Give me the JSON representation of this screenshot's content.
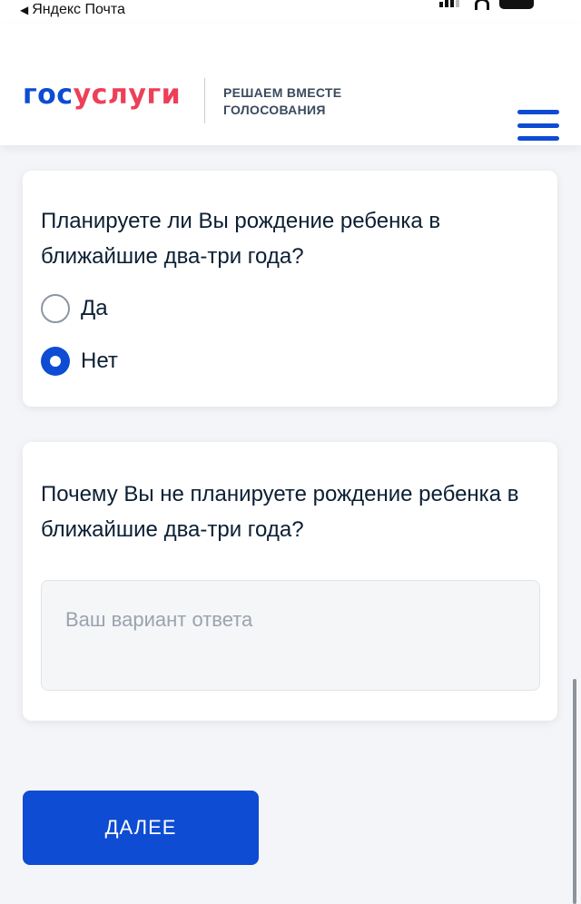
{
  "status_bar": {
    "back_app": "Яндекс Почта",
    "back_glyph": "◀"
  },
  "header": {
    "logo_part1": "гос",
    "logo_part2": "услуги",
    "tagline_line1": "РЕШАЕМ ВМЕСТЕ",
    "tagline_line2": "ГОЛОСОВАНИЯ"
  },
  "question1": {
    "text": "Планируете ли Вы рождение ребенка в ближайшие два-три года?",
    "options": [
      {
        "label": "Да",
        "selected": false
      },
      {
        "label": "Нет",
        "selected": true
      }
    ]
  },
  "question2": {
    "text": "Почему Вы не планируете рождение ребенка в ближайшие два-три года?",
    "placeholder": "Ваш вариант ответа",
    "value": ""
  },
  "next_button": {
    "label": "ДАЛЕЕ"
  },
  "colors": {
    "brand_blue": "#0d4cd3",
    "brand_red": "#ee3f58"
  }
}
